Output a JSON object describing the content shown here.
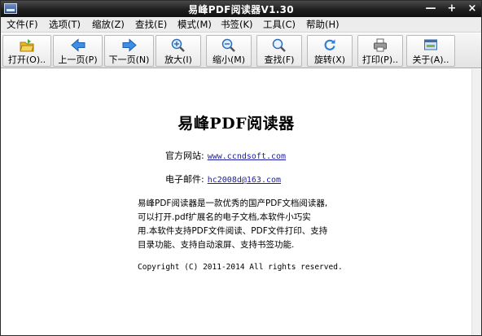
{
  "window": {
    "title": "易峰PDF阅读器V1.30",
    "controls": {
      "minimize": "—",
      "maximize": "+",
      "close": "×"
    }
  },
  "menu": [
    "文件(F)",
    "选项(T)",
    "缩放(Z)",
    "查找(E)",
    "模式(M)",
    "书签(K)",
    "工具(C)",
    "帮助(H)"
  ],
  "toolbar": [
    {
      "label": "打开(O)..",
      "icon": "open-folder-icon"
    },
    {
      "label": "上一页(P)",
      "icon": "arrow-left-icon"
    },
    {
      "label": "下一页(N)",
      "icon": "arrow-right-icon"
    },
    {
      "label": "放大(I)",
      "icon": "zoom-in-icon"
    },
    {
      "label": "缩小(M)",
      "icon": "zoom-out-icon"
    },
    {
      "label": "查找(F)",
      "icon": "search-icon"
    },
    {
      "label": "旋转(X)",
      "icon": "rotate-icon"
    },
    {
      "label": "打印(P)..",
      "icon": "printer-icon"
    },
    {
      "label": "关于(A)..",
      "icon": "about-icon"
    }
  ],
  "document": {
    "title": "易峰PDF阅读器",
    "website_label": "官方网站:",
    "website_url": "www.ccndsoft.com",
    "email_label": "电子邮件:",
    "email": "hc2008d@163.com",
    "description_lines": [
      "易峰PDF阅读器是一款优秀的国产PDF文档阅读器,",
      "可以打开.pdf扩展名的电子文档,本软件小巧实",
      "用.本软件支持PDF文件阅读、PDF文件打印、支持",
      "目录功能、支持自动滚屏、支持书签功能."
    ],
    "copyright": "Copyright (C) 2011-2014 All rights reserved."
  },
  "colors": {
    "titlebar": "#1e1e1e",
    "link": "#1a1aa8",
    "icon_blue": "#2f7fd8",
    "icon_folder": "#e9b92d"
  }
}
